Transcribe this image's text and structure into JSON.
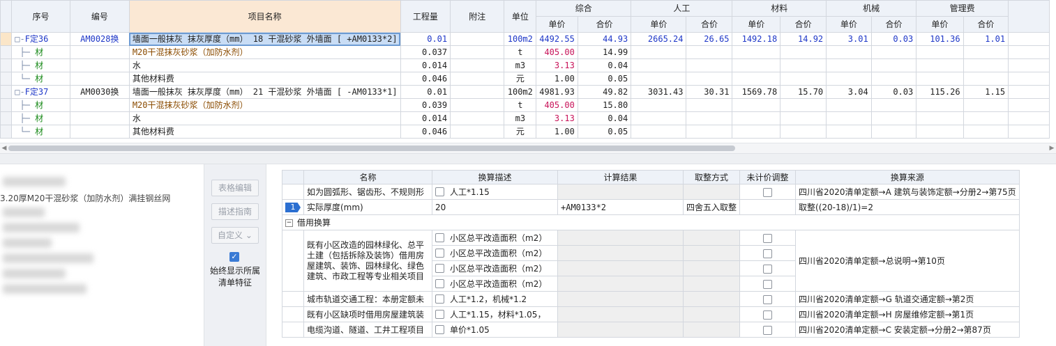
{
  "top_grid": {
    "headers": {
      "seq": "序号",
      "code": "编号",
      "name": "项目名称",
      "qty": "工程量",
      "note": "附注",
      "unit": "单位",
      "groups": [
        "综合",
        "人工",
        "材料",
        "机械",
        "管理费"
      ],
      "unit_price": "单价",
      "total_price": "合价"
    },
    "rows": [
      {
        "kind": "quota",
        "seq": "F定36",
        "code": "AM0028换",
        "name": "墙面一般抹灰 抹灰厚度（mm） 18 干混砂浆 外墙面 [ +AM0133*2]",
        "qty": "0.01",
        "note": "",
        "unit": "100m2",
        "p1": "4492.55",
        "t1": "44.93",
        "p2": "2665.24",
        "t2": "26.65",
        "p3": "1492.18",
        "t3": "14.92",
        "p4": "3.01",
        "t4": "0.03",
        "p5": "101.36",
        "t5": "1.01"
      },
      {
        "kind": "mat",
        "seq": "材",
        "code": "",
        "name": "M20干混抹灰砂浆（加防水剂）",
        "qty": "0.037",
        "note": "",
        "unit": "t",
        "p1": "405.00",
        "t1": "14.99"
      },
      {
        "kind": "mat",
        "seq": "材",
        "code": "",
        "name": "水",
        "qty": "0.014",
        "note": "",
        "unit": "m3",
        "p1": "3.13",
        "t1": "0.04"
      },
      {
        "kind": "mat",
        "seq": "材",
        "code": "",
        "name": "其他材料费",
        "qty": "0.046",
        "note": "",
        "unit": "元",
        "p1": "1.00",
        "t1": "0.05"
      },
      {
        "kind": "quota",
        "seq": "F定37",
        "code": "AM0030换",
        "name": "墙面一般抹灰 抹灰厚度（mm） 21 干混砂浆 外墙面 [ -AM0133*1]",
        "qty": "0.01",
        "note": "",
        "unit": "100m2",
        "p1": "4981.93",
        "t1": "49.82",
        "p2": "3031.43",
        "t2": "30.31",
        "p3": "1569.78",
        "t3": "15.70",
        "p4": "3.04",
        "t4": "0.03",
        "p5": "115.26",
        "t5": "1.15"
      },
      {
        "kind": "mat",
        "seq": "材",
        "code": "",
        "name": "M20干混抹灰砂浆（加防水剂）",
        "qty": "0.039",
        "note": "",
        "unit": "t",
        "p1": "405.00",
        "t1": "15.80"
      },
      {
        "kind": "mat",
        "seq": "材",
        "code": "",
        "name": "水",
        "qty": "0.014",
        "note": "",
        "unit": "m3",
        "p1": "3.13",
        "t1": "0.04"
      },
      {
        "kind": "mat",
        "seq": "材",
        "code": "",
        "name": "其他材料费",
        "qty": "0.046",
        "note": "",
        "unit": "元",
        "p1": "1.00",
        "t1": "0.05"
      }
    ]
  },
  "left_panel": {
    "feature_text": "3.20厚M20干混砂浆（加防水剂）满挂钢丝网"
  },
  "tools": {
    "table_edit": "表格编辑",
    "guide": "描述指南",
    "custom": "自定义",
    "always_show": "始终显示所属清单特征"
  },
  "conversion": {
    "headers": [
      "名称",
      "换算描述",
      "计算结果",
      "取整方式",
      "未计价调整",
      "换算来源"
    ],
    "rows": [
      {
        "name": "如为圆弧形、锯齿形、不规则形",
        "desc": "人工*1.15",
        "result": "",
        "round": "",
        "source": "四川省2020清单定额→A 建筑与装饰定额→分册2→第75页"
      },
      {
        "marker": "1",
        "name": "实际厚度(mm)",
        "desc": "20",
        "result": "+AM0133*2",
        "round": "四舍五入取整",
        "source": "取整((20-18)/1)=2"
      }
    ],
    "group_label": "借用换算",
    "group_rows": {
      "name": "既有小区改造的园林绿化、总平土建（包括拆除及装饰）借用房屋建筑、装饰、园林绿化、绿色建筑、市政工程等专业相关项目",
      "options": [
        "小区总平改造面积（m2）",
        "小区总平改造面积（m2）",
        "小区总平改造面积（m2）",
        "小区总平改造面积（m2）"
      ],
      "source": "四川省2020清单定额→总说明→第10页"
    },
    "tail_rows": [
      {
        "name": "城市轨道交通工程：本册定额未",
        "desc": "人工*1.2，机械*1.2",
        "source": "四川省2020清单定额→G 轨道交通定额→第2页"
      },
      {
        "name": "既有小区缺项时借用房屋建筑装",
        "desc": "人工*1.15，材料*1.05，",
        "source": "四川省2020清单定额→H 房屋维修定额→第1页"
      },
      {
        "name": "电缆沟道、隧道、工井工程项目",
        "desc": "单价*1.05",
        "source": "四川省2020清单定额→C 安装定额→分册2→第87页"
      }
    ]
  }
}
